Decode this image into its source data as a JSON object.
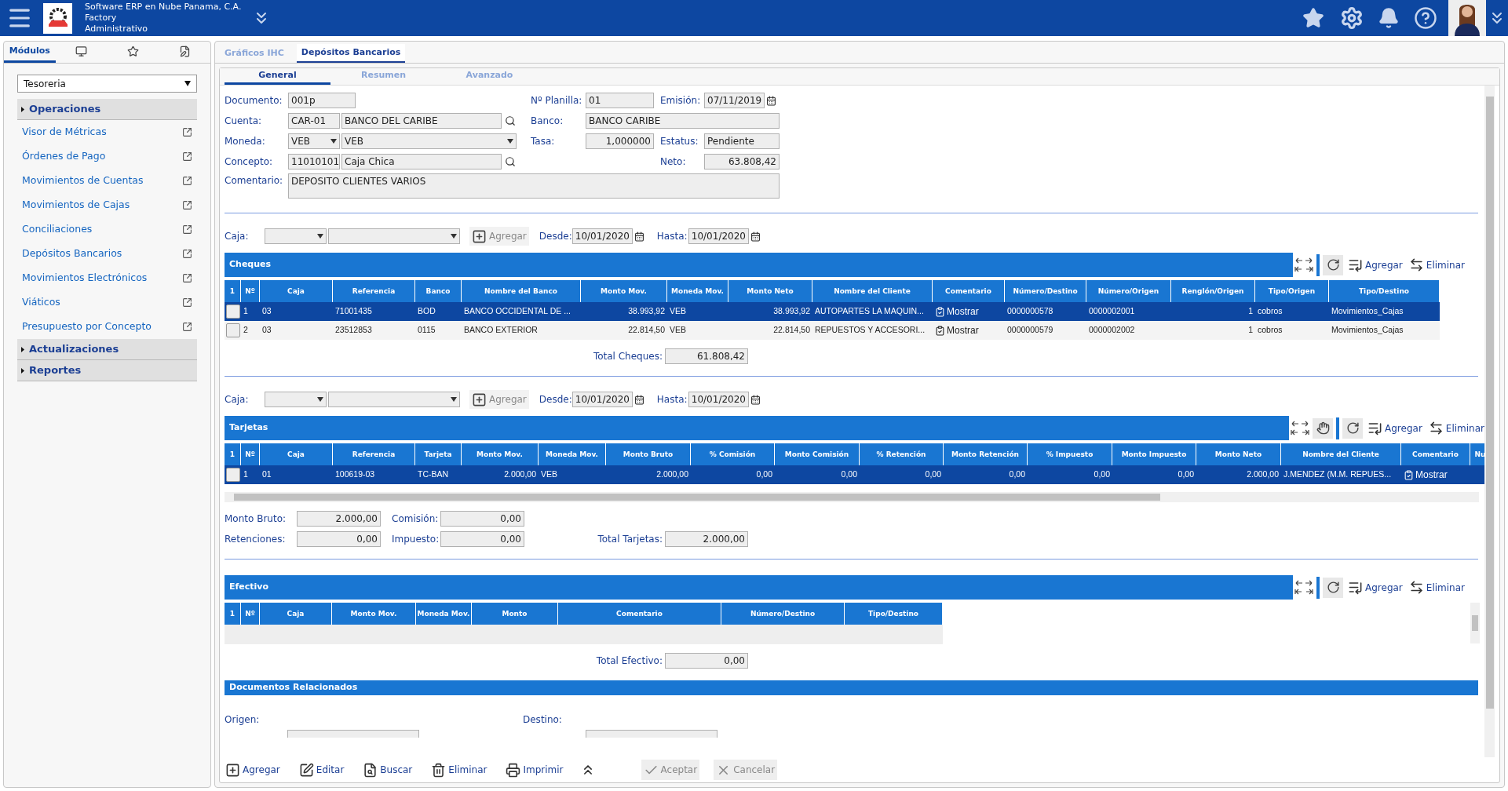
{
  "app_bar": {
    "company": "Software ERP en Nube Panama, C.A.",
    "line_2": "Factory",
    "line_3": "Administrativo"
  },
  "sidebar": {
    "tabs": [
      {
        "kind": "text",
        "label": "Módulos",
        "selected": true
      },
      {
        "kind": "monitor",
        "selected": false
      },
      {
        "kind": "star",
        "selected": false
      },
      {
        "kind": "document",
        "selected": false
      }
    ],
    "module": "Tesoreria",
    "menu": [
      {
        "kind": "group",
        "label": "Operaciones"
      },
      {
        "kind": "link",
        "label": "Visor de Métricas"
      },
      {
        "kind": "link",
        "label": "Órdenes de Pago"
      },
      {
        "kind": "link",
        "label": "Movimientos de Cuentas"
      },
      {
        "kind": "link",
        "label": "Movimientos de Cajas"
      },
      {
        "kind": "link",
        "label": "Conciliaciones"
      },
      {
        "kind": "link",
        "label": "Depósitos Bancarios"
      },
      {
        "kind": "link",
        "label": "Movimientos Electrónicos"
      },
      {
        "kind": "link",
        "label": "Viáticos"
      },
      {
        "kind": "link",
        "label": "Presupuesto por Concepto"
      },
      {
        "kind": "group",
        "label": "Actualizaciones"
      },
      {
        "kind": "group",
        "label": "Reportes"
      }
    ]
  },
  "tabs": [
    {
      "label": "Gráficos IHC",
      "selected": false
    },
    {
      "label": "Depósitos Bancarios",
      "selected": true
    }
  ],
  "sub_tabs": [
    {
      "label": "General",
      "selected": true
    },
    {
      "label": "Resumen",
      "selected": false
    },
    {
      "label": "Avanzado",
      "selected": false
    }
  ],
  "form": {
    "documento": {
      "label": "Documento:",
      "value": "001p"
    },
    "planilla": {
      "label": "Nº Planilla:",
      "value": "01"
    },
    "emision": {
      "label": "Emisión:",
      "value": "07/11/2019"
    },
    "cuenta": {
      "label": "Cuenta:",
      "code": "CAR-01",
      "name": "BANCO DEL CARIBE"
    },
    "banco": {
      "label": "Banco:",
      "value": "BANCO CARIBE"
    },
    "moneda": {
      "label": "Moneda:",
      "code": "VEB",
      "name": "VEB"
    },
    "tasa": {
      "label": "Tasa:",
      "value": "1,000000"
    },
    "estatus": {
      "label": "Estatus:",
      "value": "Pendiente"
    },
    "concepto": {
      "label": "Concepto:",
      "code": "11010101",
      "name": "Caja Chica"
    },
    "neto": {
      "label": "Neto:",
      "value": "63.808,42"
    },
    "comentario": {
      "label": "Comentario:",
      "value": "DEPOSITO CLIENTES VARIOS"
    }
  },
  "sections": [
    {
      "kind": "cheques",
      "title": "Cheques",
      "extra_tool": false,
      "add": "Agregar",
      "remove": "Eliminar",
      "filter": {
        "caja_label": "Caja:",
        "add": "Agregar",
        "from_label": "Desde:",
        "from": "10/01/2020",
        "to_label": "Hasta:",
        "to": "10/01/2020"
      },
      "columns": [
        {
          "label": "1",
          "kind": "check"
        },
        {
          "label": "Nº",
          "kind": "text"
        },
        {
          "label": "Caja",
          "kind": "text"
        },
        {
          "label": "Referencia",
          "kind": "text"
        },
        {
          "label": "Banco",
          "kind": "text"
        },
        {
          "label": "Nombre del Banco",
          "kind": "text"
        },
        {
          "label": "Monto Mov.",
          "kind": "number"
        },
        {
          "label": "Moneda Mov.",
          "kind": "text"
        },
        {
          "label": "Monto Neto",
          "kind": "number"
        },
        {
          "label": "Nombre del Cliente",
          "kind": "text"
        },
        {
          "label": "Comentario",
          "kind": "comment"
        },
        {
          "label": "Número/Destino",
          "kind": "text"
        },
        {
          "label": "Número/Origen",
          "kind": "text"
        },
        {
          "label": "Renglón/Origen",
          "kind": "number"
        },
        {
          "label": "Tipo/Origen",
          "kind": "text"
        },
        {
          "label": "Tipo/Destino",
          "kind": "text"
        }
      ],
      "rows": [
        {
          "selected": true,
          "cells": [
            "",
            "1",
            "03",
            "71001435",
            "BOD",
            "BANCO OCCIDENTAL DE ...",
            "38.993,92",
            "VEB",
            "38.993,92",
            "AUTOPARTES LA MAQUIN...",
            "Mostrar",
            "0000000578",
            "0000002001",
            "1",
            "cobros",
            "Movimientos_Cajas"
          ]
        },
        {
          "selected": false,
          "cells": [
            "",
            "2",
            "03",
            "23512853",
            "0115",
            "BANCO EXTERIOR",
            "22.814,50",
            "VEB",
            "22.814,50",
            "REPUESTOS Y ACCESORI...",
            "Mostrar",
            "0000000579",
            "0000002002",
            "1",
            "cobros",
            "Movimientos_Cajas"
          ]
        }
      ],
      "totals": [
        [
          {
            "kind": "total",
            "label": "Total Cheques:",
            "value": "61.808,42"
          }
        ]
      ]
    },
    {
      "kind": "tarjetas",
      "title": "Tarjetas",
      "extra_tool": true,
      "add": "Agregar",
      "remove": "Eliminar",
      "filter": {
        "caja_label": "Caja:",
        "add": "Agregar",
        "from_label": "Desde:",
        "from": "10/01/2020",
        "to_label": "Hasta:",
        "to": "10/01/2020"
      },
      "columns": [
        {
          "label": "1",
          "kind": "check"
        },
        {
          "label": "Nº",
          "kind": "text"
        },
        {
          "label": "Caja",
          "kind": "text"
        },
        {
          "label": "Referencia",
          "kind": "text"
        },
        {
          "label": "Tarjeta",
          "kind": "text"
        },
        {
          "label": "Monto Mov.",
          "kind": "number"
        },
        {
          "label": "Moneda Mov.",
          "kind": "text"
        },
        {
          "label": "Monto Bruto",
          "kind": "number"
        },
        {
          "label": "% Comisión",
          "kind": "number"
        },
        {
          "label": "Monto Comisión",
          "kind": "number"
        },
        {
          "label": "% Retención",
          "kind": "number"
        },
        {
          "label": "Monto Retención",
          "kind": "number"
        },
        {
          "label": "% Impuesto",
          "kind": "number"
        },
        {
          "label": "Monto Impuesto",
          "kind": "number"
        },
        {
          "label": "Monto Neto",
          "kind": "number"
        },
        {
          "label": "Nombre del Cliente",
          "kind": "text"
        },
        {
          "label": "Comentario",
          "kind": "comment"
        },
        {
          "label": "Nu",
          "kind": "text"
        }
      ],
      "rows": [
        {
          "selected": true,
          "cells": [
            "",
            "1",
            "01",
            "100619-03",
            "TC-BAN",
            "2.000,00",
            "VEB",
            "2.000,00",
            "0,00",
            "0,00",
            "0,00",
            "0,00",
            "0,00",
            "0,00",
            "2.000,00",
            "J.MENDEZ (M.M. REPUES...",
            "Mostrar"
          ]
        }
      ],
      "totals": [
        [
          {
            "kind": "field",
            "label": "Monto Bruto:",
            "value": "2.000,00"
          },
          {
            "kind": "field",
            "label": "Comisión:",
            "value": "0,00"
          }
        ],
        [
          {
            "kind": "field",
            "label": "Retenciones:",
            "value": "0,00"
          },
          {
            "kind": "field",
            "label": "Impuesto:",
            "value": "0,00"
          },
          {
            "kind": "total",
            "label": "Total Tarjetas:",
            "value": "2.000,00"
          }
        ]
      ]
    },
    {
      "kind": "efectivo",
      "title": "Efectivo",
      "extra_tool": false,
      "add": "Agregar",
      "remove": "Eliminar",
      "columns": [
        {
          "label": "1"
        },
        {
          "label": "Nº"
        },
        {
          "label": "Caja"
        },
        {
          "label": "Monto Mov."
        },
        {
          "label": "Moneda Mov."
        },
        {
          "label": "Monto"
        },
        {
          "label": "Comentario"
        },
        {
          "label": "Número/Destino"
        },
        {
          "label": "Tipo/Destino"
        }
      ],
      "totals": [
        [
          {
            "kind": "total",
            "label": "Total Efectivo:",
            "value": "0,00"
          }
        ]
      ]
    }
  ],
  "related": {
    "title": "Documentos Relacionados",
    "origin_label": "Origen:",
    "destination_label": "Destino:"
  },
  "toolbar": [
    {
      "kind": "add",
      "label": "Agregar",
      "disabled": false
    },
    {
      "kind": "edit",
      "label": "Editar",
      "disabled": false
    },
    {
      "kind": "search",
      "label": "Buscar",
      "disabled": false
    },
    {
      "kind": "delete",
      "label": "Eliminar",
      "disabled": false
    },
    {
      "kind": "print",
      "label": "Imprimir",
      "disabled": false
    },
    {
      "kind": "collapse"
    },
    {
      "kind": "accept",
      "label": "Aceptar",
      "disabled": true
    },
    {
      "kind": "cancel",
      "label": "Cancelar",
      "disabled": true
    }
  ]
}
